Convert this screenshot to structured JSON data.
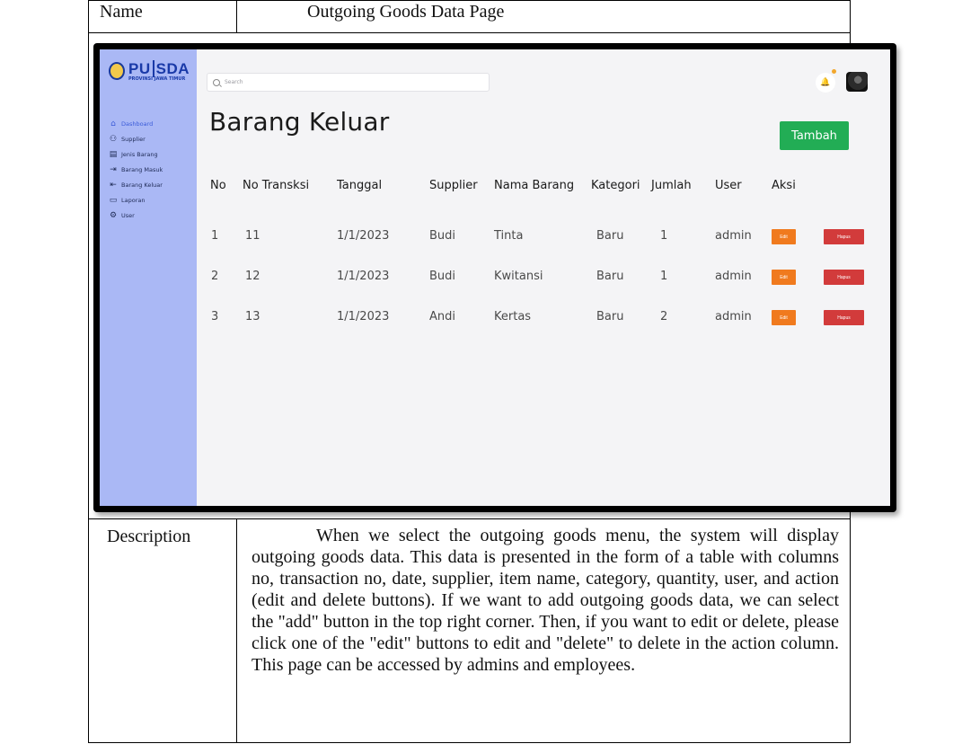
{
  "document": {
    "name_label": "Name",
    "name_value": "Outgoing Goods Data Page",
    "description_label": "Description",
    "description_text": "When we select the outgoing goods menu, the system will display outgoing goods data. This data is presented in the form of a table with columns no, transaction no, date, supplier, item name, category, quantity, user, and action (edit and delete buttons). If we want to add outgoing goods data, we can select the \"add\" button in the top right corner. Then, if you want to edit or delete, please click one of the \"edit\" buttons to edit and \"delete\" to delete in the action column. This page can be accessed by admins and employees."
  },
  "app": {
    "logo_main": "PU",
    "logo_main2": "SDA",
    "logo_sub": "PROVINSI JAWA TIMUR",
    "search_placeholder": "Search",
    "page_title": "Barang Keluar",
    "add_button": "Tambah",
    "sidebar": [
      {
        "label": "Dashboard",
        "icon": "home-icon"
      },
      {
        "label": "Supplier",
        "icon": "network-icon"
      },
      {
        "label": "Jenis Barang",
        "icon": "clipboard-icon"
      },
      {
        "label": "Barang Masuk",
        "icon": "login-icon"
      },
      {
        "label": "Barang Keluar",
        "icon": "logout-icon"
      },
      {
        "label": "Laporan",
        "icon": "report-icon"
      },
      {
        "label": "User",
        "icon": "gear-icon"
      }
    ],
    "table": {
      "headers": [
        "No",
        "No Transksi",
        "Tanggal",
        "Supplier",
        "Nama Barang",
        "Kategori",
        "Jumlah",
        "User",
        "Aksi"
      ],
      "rows": [
        [
          "1",
          "11",
          "1/1/2023",
          "Budi",
          "Tinta",
          "Baru",
          "1",
          "admin"
        ],
        [
          "2",
          "12",
          "1/1/2023",
          "Budi",
          "Kwitansi",
          "Baru",
          "1",
          "admin"
        ],
        [
          "3",
          "13",
          "1/1/2023",
          "Andi",
          "Kertas",
          "Baru",
          "2",
          "admin"
        ]
      ],
      "edit_label": "Edit",
      "delete_label": "Hapus"
    }
  },
  "colors": {
    "sidebar": "#aab8f5",
    "add_button": "#22ad55",
    "edit_button": "#f07a1e",
    "delete_button": "#d23b3b"
  }
}
